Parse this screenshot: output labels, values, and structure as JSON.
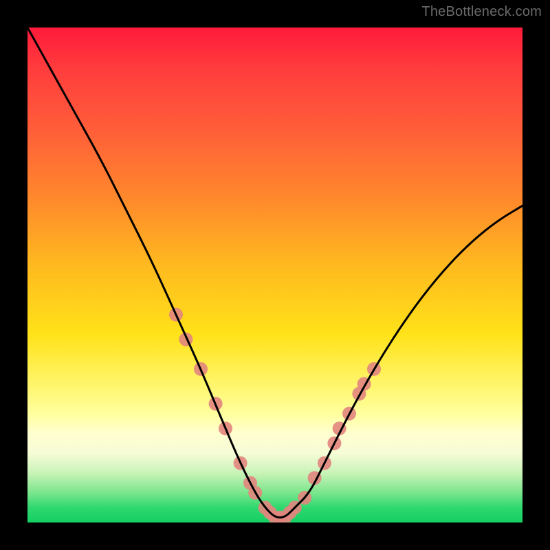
{
  "watermark": "TheBottleneck.com",
  "chart_data": {
    "type": "line",
    "title": "",
    "xlabel": "",
    "ylabel": "",
    "xlim": [
      0,
      100
    ],
    "ylim": [
      0,
      100
    ],
    "grid": false,
    "series": [
      {
        "name": "bottleneck-curve",
        "color": "#000000",
        "x": [
          0,
          5,
          10,
          15,
          20,
          25,
          30,
          35,
          40,
          43,
          46,
          48,
          50,
          52,
          54,
          57,
          60,
          65,
          70,
          75,
          80,
          85,
          90,
          95,
          100
        ],
        "y": [
          100,
          91,
          82,
          73,
          63,
          53,
          42,
          31,
          19,
          12,
          6,
          3,
          1,
          1,
          3,
          6,
          12,
          22,
          31,
          39,
          46,
          52,
          57,
          61,
          64
        ]
      }
    ],
    "markers": {
      "name": "highlighted-points",
      "color": "#e2857e",
      "radius": 10,
      "points": [
        {
          "x": 30,
          "y": 42
        },
        {
          "x": 32,
          "y": 37
        },
        {
          "x": 35,
          "y": 31
        },
        {
          "x": 38,
          "y": 24
        },
        {
          "x": 40,
          "y": 19
        },
        {
          "x": 43,
          "y": 12
        },
        {
          "x": 45,
          "y": 8
        },
        {
          "x": 46,
          "y": 6
        },
        {
          "x": 48,
          "y": 3
        },
        {
          "x": 49,
          "y": 2
        },
        {
          "x": 50,
          "y": 1
        },
        {
          "x": 51,
          "y": 1
        },
        {
          "x": 52,
          "y": 1
        },
        {
          "x": 53,
          "y": 2
        },
        {
          "x": 54,
          "y": 3
        },
        {
          "x": 56,
          "y": 5
        },
        {
          "x": 58,
          "y": 9
        },
        {
          "x": 60,
          "y": 12
        },
        {
          "x": 62,
          "y": 16
        },
        {
          "x": 63,
          "y": 19
        },
        {
          "x": 65,
          "y": 22
        },
        {
          "x": 67,
          "y": 26
        },
        {
          "x": 68,
          "y": 28
        },
        {
          "x": 70,
          "y": 31
        }
      ]
    }
  }
}
